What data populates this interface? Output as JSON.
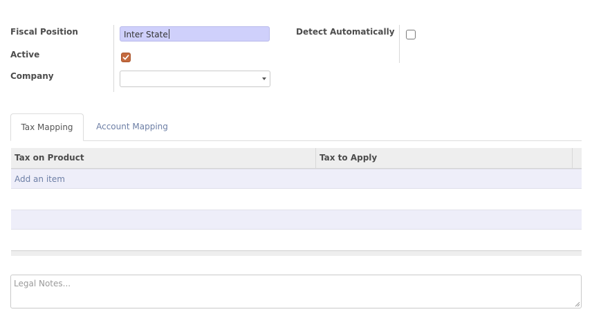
{
  "form": {
    "fiscal_position_label": "Fiscal Position",
    "fiscal_position_value": "Inter State",
    "active_label": "Active",
    "active_checked": true,
    "company_label": "Company",
    "company_value": "",
    "detect_label": "Detect Automatically",
    "detect_checked": false
  },
  "tabs": [
    {
      "label": "Tax Mapping",
      "active": true
    },
    {
      "label": "Account Mapping",
      "active": false
    }
  ],
  "table": {
    "columns": [
      "Tax on Product",
      "Tax to Apply"
    ],
    "add_item_label": "Add an item"
  },
  "notes": {
    "placeholder": "Legal Notes..."
  },
  "colors": {
    "accent_checkbox": "#c46a3f",
    "input_highlight": "#cfd0fb",
    "link": "#6c7ea5"
  }
}
